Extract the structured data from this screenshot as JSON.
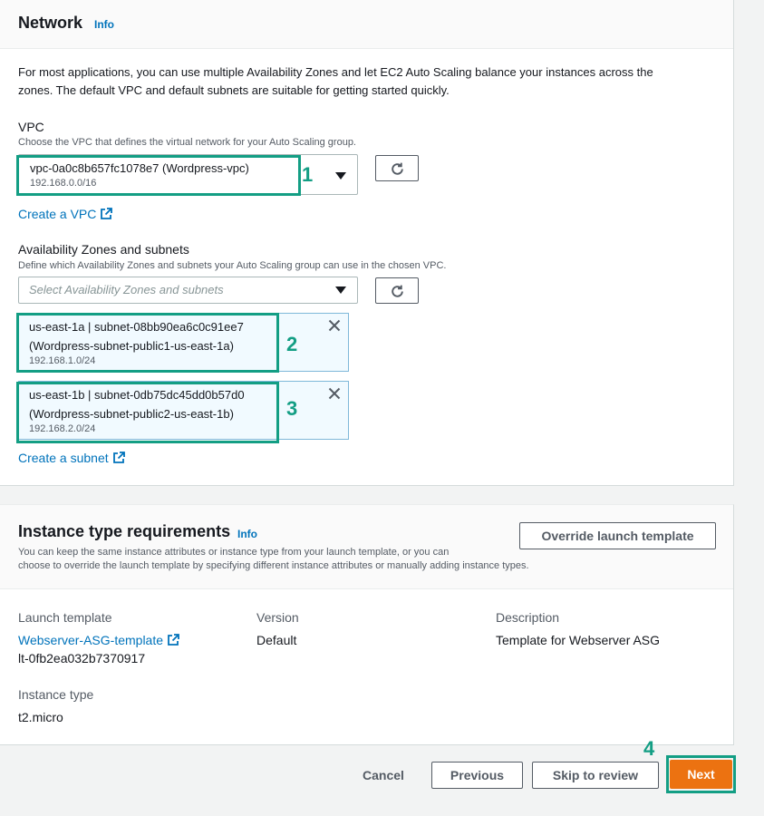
{
  "network": {
    "title": "Network",
    "info": "Info",
    "description_line1": "For most applications, you can use multiple Availability Zones and let EC2 Auto Scaling balance your instances across the",
    "description_line2": "zones. The default VPC and default subnets are suitable for getting started quickly.",
    "vpc": {
      "label": "VPC",
      "help": "Choose the VPC that defines the virtual network for your Auto Scaling group.",
      "selected": "vpc-0a0c8b657fc1078e7 (Wordpress-vpc)",
      "cidr": "192.168.0.0/16",
      "create_link": "Create a VPC"
    },
    "azs": {
      "label": "Availability Zones and subnets",
      "help": "Define which Availability Zones and subnets your Auto Scaling group can use in the chosen VPC.",
      "placeholder": "Select Availability Zones and subnets",
      "tokens": [
        {
          "line1": "us-east-1a | subnet-08bb90ea6c0c91ee7",
          "line2": "(Wordpress-subnet-public1-us-east-1a)",
          "cidr": "192.168.1.0/24"
        },
        {
          "line1": "us-east-1b | subnet-0db75dc45dd0b57d0",
          "line2": "(Wordpress-subnet-public2-us-east-1b)",
          "cidr": "192.168.2.0/24"
        }
      ],
      "create_link": "Create a subnet"
    }
  },
  "instance": {
    "title": "Instance type requirements",
    "info": "Info",
    "override_button": "Override launch template",
    "description_line1": "You can keep the same instance attributes or instance type from your launch template, or you can",
    "description_line2": "choose to override the launch template by specifying different instance attributes or manually adding instance types.",
    "launch_template_label": "Launch template",
    "launch_template_name": "Webserver-ASG-template",
    "launch_template_id": "lt-0fb2ea032b7370917",
    "version_label": "Version",
    "version_value": "Default",
    "description_label": "Description",
    "description_value": "Template for Webserver ASG",
    "instance_type_label": "Instance type",
    "instance_type_value": "t2.micro"
  },
  "footer": {
    "cancel": "Cancel",
    "previous": "Previous",
    "skip": "Skip to review",
    "next": "Next"
  },
  "annotations": [
    "1",
    "2",
    "3",
    "4"
  ],
  "colors": {
    "accent": "#139e84",
    "primary": "#ec7211",
    "link": "#0073bb"
  }
}
